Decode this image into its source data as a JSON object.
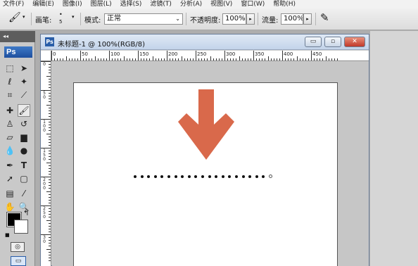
{
  "menu": [
    "文件(F)",
    "编辑(E)",
    "图像(I)",
    "图层(L)",
    "选择(S)",
    "滤镜(T)",
    "分析(A)",
    "视图(V)",
    "窗口(W)",
    "帮助(H)"
  ],
  "options": {
    "brush_label": "画笔:",
    "brush_size": "5",
    "mode_label": "模式:",
    "mode_value": "正常",
    "opacity_label": "不透明度:",
    "opacity_value": "100%",
    "flow_label": "流量:",
    "flow_value": "100%"
  },
  "toolbox": {
    "collapse": "◂◂",
    "logo": "Ps"
  },
  "document": {
    "title": "未标题-1 @ 100%(RGB/8)",
    "app_icon": "Ps",
    "min": "▭",
    "max": "▫",
    "close": "✕"
  },
  "ruler_top": [
    "0",
    "50",
    "100",
    "150",
    "200",
    "250",
    "300",
    "350",
    "400",
    "450"
  ],
  "ruler_left": [
    "0",
    "5 0",
    "1 0 0",
    "1 5 0",
    "2 0 0",
    "2 5 0",
    "3 0"
  ],
  "canvas": {
    "arrow_color": "#d9694b",
    "dot_count": 21
  },
  "colors": {
    "foreground": "#000000",
    "background": "#ffffff"
  },
  "icons": {
    "brush_tool": "brush-icon",
    "airbrush": "airbrush-icon"
  }
}
